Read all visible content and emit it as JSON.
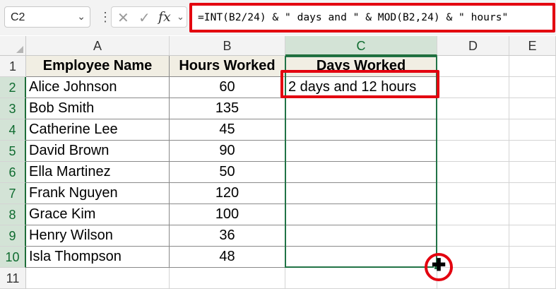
{
  "formula_bar": {
    "name_box": "C2",
    "formula": "=INT(B2/24) & \" days and \" & MOD(B2,24) & \" hours\""
  },
  "icons": {
    "dropdown": "chevron-down-icon",
    "more": "vertical-dots-icon",
    "cancel": "x-icon",
    "enter": "check-icon",
    "function": "fx-icon",
    "cursor": "plus-cross-cursor-icon"
  },
  "glyphs": {
    "chevron": "⌄",
    "dots": "⋮",
    "x": "✕",
    "check": "✓",
    "fx": "fx",
    "plus": "✚"
  },
  "columns": [
    "A",
    "B",
    "C",
    "D",
    "E"
  ],
  "rows": [
    "1",
    "2",
    "3",
    "4",
    "5",
    "6",
    "7",
    "8",
    "9",
    "10",
    "11"
  ],
  "headers": {
    "a": "Employee Name",
    "b": "Hours Worked",
    "c": "Days Worked"
  },
  "data": [
    {
      "name": "Alice Johnson",
      "hours": "60",
      "days": "2 days and 12 hours"
    },
    {
      "name": "Bob Smith",
      "hours": "135",
      "days": ""
    },
    {
      "name": "Catherine Lee",
      "hours": "45",
      "days": ""
    },
    {
      "name": "David Brown",
      "hours": "90",
      "days": ""
    },
    {
      "name": "Ella Martinez",
      "hours": "50",
      "days": ""
    },
    {
      "name": "Frank Nguyen",
      "hours": "120",
      "days": ""
    },
    {
      "name": "Grace Kim",
      "hours": "100",
      "days": ""
    },
    {
      "name": "Henry Wilson",
      "hours": "36",
      "days": ""
    },
    {
      "name": "Isla Thompson",
      "hours": "48",
      "days": ""
    }
  ],
  "colors": {
    "highlight": "#e3000f",
    "selection": "#217346",
    "header_fill": "#f1eee3"
  }
}
